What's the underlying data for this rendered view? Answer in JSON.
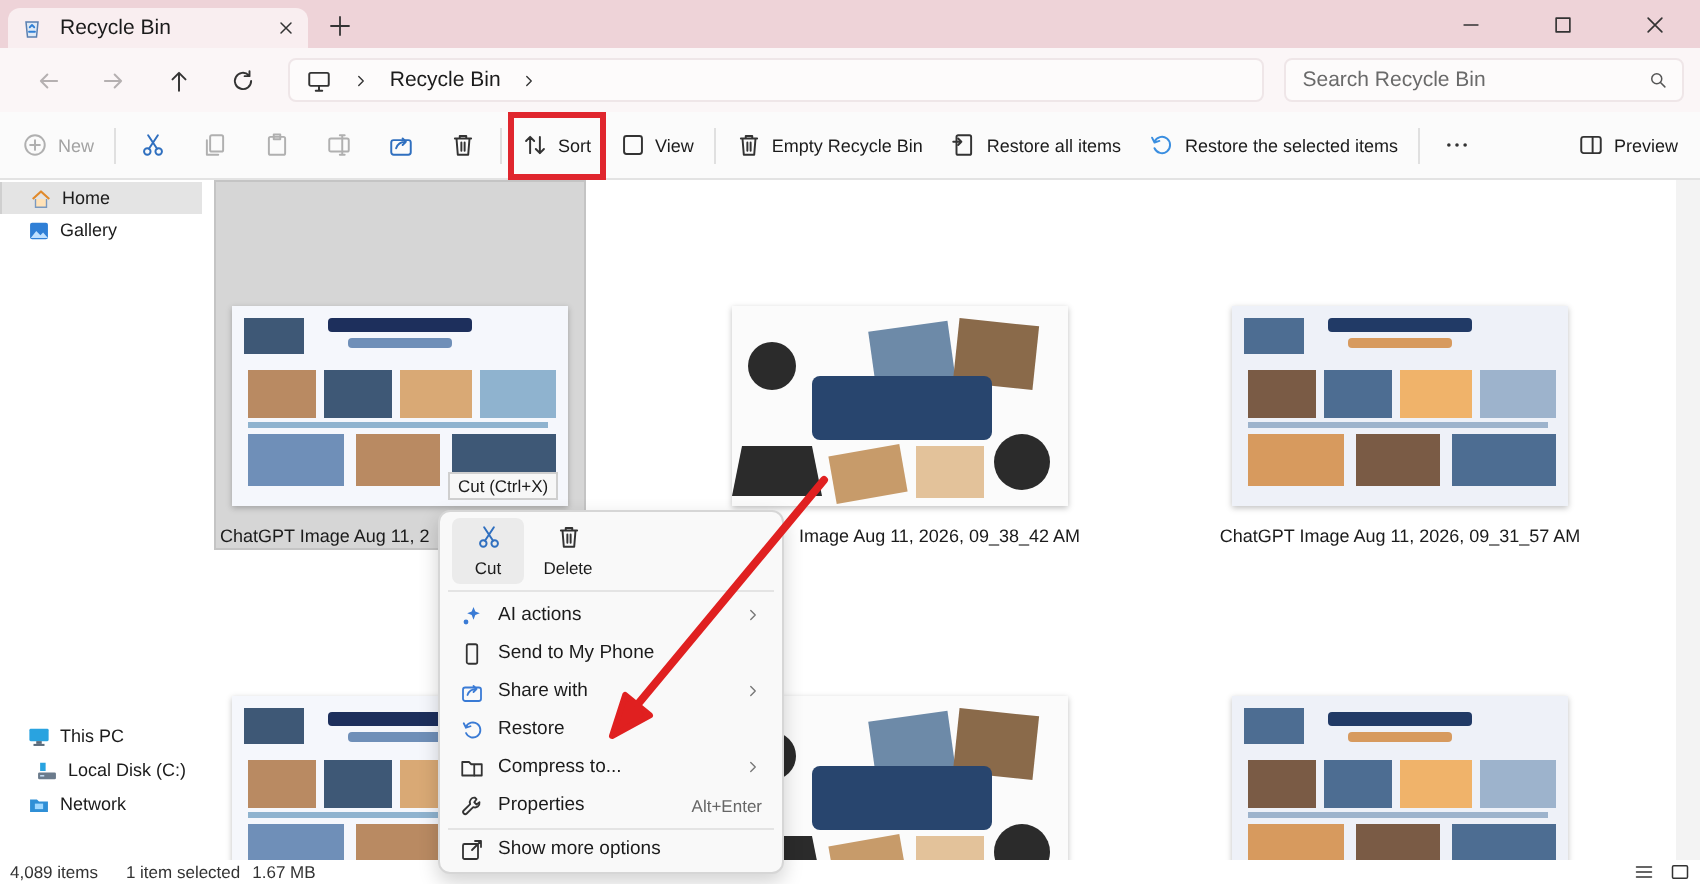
{
  "window": {
    "tabs": [
      {
        "label": "Recycle Bin",
        "selected": true
      }
    ]
  },
  "navigation": [
    {
      "kind": "back",
      "disabled": true
    },
    {
      "kind": "forward",
      "disabled": true
    },
    {
      "kind": "up",
      "disabled": false
    },
    {
      "kind": "refresh",
      "disabled": false
    }
  ],
  "address_bar": {
    "path": [
      "Recycle Bin"
    ],
    "search_placeholder": "Search Recycle Bin"
  },
  "toolbar": [
    {
      "kind": "new",
      "label": "New",
      "disabled": true,
      "highlighted": false
    },
    {
      "kind": "cut",
      "disabled": false,
      "highlighted": false
    },
    {
      "kind": "copy",
      "disabled": true,
      "highlighted": false
    },
    {
      "kind": "paste",
      "disabled": true,
      "highlighted": false
    },
    {
      "kind": "rename",
      "disabled": true,
      "highlighted": false
    },
    {
      "kind": "share",
      "disabled": false,
      "highlighted": false
    },
    {
      "kind": "delete",
      "disabled": false,
      "highlighted": false
    },
    {
      "kind": "sort",
      "label": "Sort",
      "disabled": false,
      "highlighted": true
    },
    {
      "kind": "view",
      "label": "View",
      "disabled": false,
      "highlighted": false
    },
    {
      "kind": "empty",
      "label": "Empty Recycle Bin",
      "disabled": false,
      "highlighted": false
    },
    {
      "kind": "restore_all",
      "label": "Restore all items",
      "disabled": false,
      "highlighted": false
    },
    {
      "kind": "restore",
      "label": "Restore the selected items",
      "disabled": false,
      "highlighted": false
    },
    {
      "kind": "more",
      "disabled": false,
      "highlighted": false
    },
    {
      "kind": "preview",
      "label": "Preview",
      "disabled": false,
      "highlighted": false
    }
  ],
  "sidebar": {
    "items": [
      {
        "kind": "home",
        "label": "Home",
        "selected": true
      },
      {
        "kind": "gallery",
        "label": "Gallery",
        "selected": false
      }
    ],
    "locations": [
      {
        "kind": "pc",
        "label": "This PC",
        "selected": false,
        "children": [
          {
            "kind": "disk",
            "label": "Local Disk (C:)",
            "selected": false
          }
        ]
      },
      {
        "kind": "network",
        "label": "Network",
        "selected": false
      }
    ]
  },
  "files": [
    {
      "name": "ChatGPT Image Aug 11, 2",
      "selected": true,
      "kind": "picture"
    },
    {
      "name": "Image Aug 11, 2026, 09_38_42 AM",
      "selected": false,
      "kind": "picture"
    },
    {
      "name": "ChatGPT Image Aug 11, 2026, 09_31_57 AM",
      "selected": false,
      "kind": "picture"
    },
    {
      "selected": false,
      "kind": "picture"
    },
    {
      "selected": false,
      "kind": "picture"
    },
    {
      "selected": false,
      "kind": "picture"
    }
  ],
  "tooltip": "Cut (Ctrl+X)",
  "context_menu": {
    "quick_actions": [
      {
        "kind": "cut",
        "label": "Cut",
        "hovered": true
      },
      {
        "kind": "delete",
        "label": "Delete",
        "hovered": false
      }
    ],
    "items": [
      {
        "kind": "ai",
        "label": "AI actions",
        "submenu": true
      },
      {
        "kind": "phone",
        "label": "Send to My Phone",
        "submenu": false
      },
      {
        "kind": "share",
        "label": "Share with",
        "submenu": true
      },
      {
        "kind": "restore",
        "label": "Restore",
        "submenu": false
      },
      {
        "kind": "compress",
        "label": "Compress to...",
        "submenu": true
      },
      {
        "kind": "properties",
        "label": "Properties",
        "shortcut": "Alt+Enter",
        "submenu": false
      }
    ],
    "more": {
      "kind": "showmore",
      "label": "Show more options"
    }
  },
  "status_bar": {
    "item_count": "4,089 items",
    "selection": "1 item selected",
    "size": "1.67 MB"
  }
}
